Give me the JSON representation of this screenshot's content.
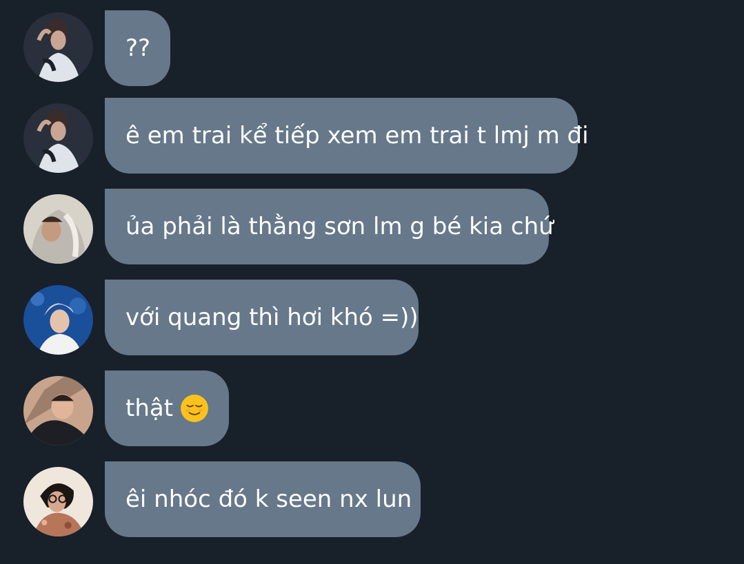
{
  "messages": [
    {
      "avatar": "avatar-user-1",
      "text": "??"
    },
    {
      "avatar": "avatar-user-1",
      "text": "ê em trai kể tiếp xem em trai t lmj m đi"
    },
    {
      "avatar": "avatar-user-2",
      "text": "ủa phải là thằng sơn lm g bé kia chứ"
    },
    {
      "avatar": "avatar-user-3",
      "text": "với quang thì hơi khó =))"
    },
    {
      "avatar": "avatar-user-4",
      "text": "thật",
      "emoji": "relieved-face-emoji"
    },
    {
      "avatar": "avatar-user-5",
      "text": "êi nhóc đó k seen nx lun"
    }
  ],
  "colors": {
    "background": "#18202a",
    "bubble": "#66788a",
    "text": "#ffffff"
  }
}
